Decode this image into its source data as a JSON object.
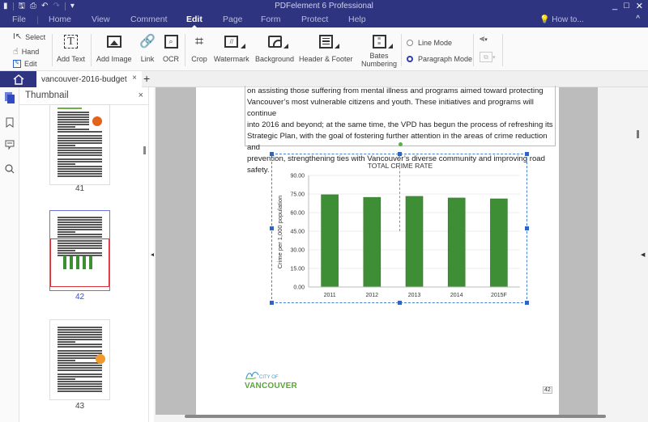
{
  "titlebar": {
    "title": "PDFelement 6 Professional",
    "quick_access": [
      "app-menu-icon",
      "save-icon",
      "print-icon",
      "undo-icon",
      "redo-icon",
      "customize-icon"
    ],
    "window_controls": {
      "minimize": "_",
      "maximize": "□",
      "close": "✕"
    }
  },
  "menu": {
    "items": [
      "File",
      "Home",
      "View",
      "Comment",
      "Edit",
      "Page",
      "Form",
      "Protect",
      "Help"
    ],
    "active": "Edit",
    "howto": "How to...",
    "collapse": "^"
  },
  "ribbon": {
    "select": "Select",
    "hand": "Hand",
    "edit": "Edit",
    "add_text": "Add Text",
    "add_image": "Add Image",
    "link": "Link",
    "ocr": "OCR",
    "crop": "Crop",
    "watermark": "Watermark",
    "background": "Background",
    "header_footer": "Header & Footer",
    "bates_1": "Bates",
    "bates_2": "Numbering",
    "line_mode": "Line Mode",
    "paragraph_mode": "Paragraph Mode",
    "selected_mode": "Paragraph Mode"
  },
  "tabs": {
    "document": "vancouver-2016-budget",
    "close": "×",
    "add": "+"
  },
  "thumbnail_panel": {
    "title": "Thumbnail",
    "close": "×",
    "pages": [
      {
        "label": "41",
        "selected": false
      },
      {
        "label": "42",
        "selected": true
      },
      {
        "label": "43",
        "selected": false
      }
    ]
  },
  "document": {
    "paragraph_lines": [
      "on assisting those suffering from mental illness and programs aimed toward protecting",
      "Vancouver’s most vulnerable citizens and youth. These initiatives and programs will continue",
      "into 2016 and beyond; at the same time, the VPD has begun the process of refreshing its",
      "Strategic Plan, with the goal of fostering further attention in the areas of crime reduction and",
      "prevention, strengthening ties with Vancouver’s diverse community and improving road",
      "safety."
    ],
    "logo_line1": "CITY OF",
    "logo_line2": "VANCOUVER",
    "page_number": "42"
  },
  "colors": {
    "brand": "#2f3480",
    "bar": "#3e8e35",
    "selection": "#2f64c4",
    "logo_green": "#5aa63a"
  },
  "chart_data": {
    "type": "bar",
    "title": "TOTAL CRIME RATE",
    "xlabel": "",
    "ylabel": "Crime per 1,000 population",
    "categories": [
      "2011",
      "2012",
      "2013",
      "2014",
      "2015F"
    ],
    "values": [
      74.4,
      72.3,
      73.1,
      71.8,
      71.1
    ],
    "ylim": [
      0,
      90
    ],
    "yticks": [
      "0.00",
      "15.00",
      "30.00",
      "45.00",
      "60.00",
      "75.00",
      "90.00"
    ],
    "grid": true,
    "legend": "none"
  }
}
